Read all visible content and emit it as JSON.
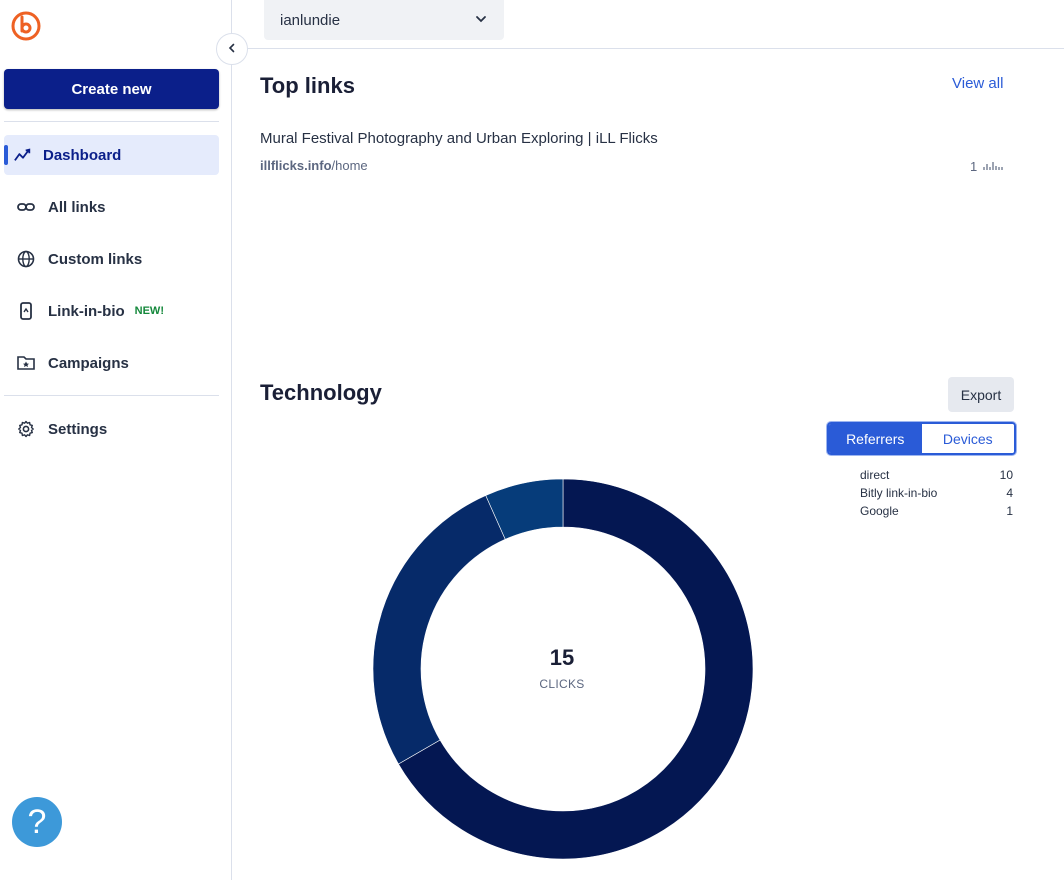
{
  "sidebar": {
    "create_label": "Create new",
    "items": [
      {
        "label": "Dashboard",
        "icon": "chart-trend-icon"
      },
      {
        "label": "All links",
        "icon": "link-icon"
      },
      {
        "label": "Custom links",
        "icon": "globe-icon"
      },
      {
        "label": "Link-in-bio",
        "icon": "phone-icon",
        "badge": "NEW!"
      },
      {
        "label": "Campaigns",
        "icon": "folder-star-icon"
      },
      {
        "label": "Settings",
        "icon": "gear-icon"
      }
    ],
    "help_label": "?"
  },
  "topbar": {
    "account": "ianlundie"
  },
  "top_links": {
    "title": "Top links",
    "view_all": "View all",
    "links": [
      {
        "title": "Mural Festival Photography and Urban Exploring | iLL Flicks",
        "domain": "illflicks.info",
        "path": "/home",
        "clicks": "1"
      }
    ]
  },
  "technology": {
    "title": "Technology",
    "export_label": "Export",
    "tabs": [
      "Referrers",
      "Devices"
    ],
    "active_tab": "Referrers",
    "legend": [
      {
        "name": "direct",
        "value": "10"
      },
      {
        "name": "Bitly link-in-bio",
        "value": "4"
      },
      {
        "name": "Google",
        "value": "1"
      }
    ],
    "total": "15",
    "total_label": "CLICKS"
  },
  "chart_data": {
    "type": "pie",
    "categories": [
      "direct",
      "Bitly link-in-bio",
      "Google"
    ],
    "values": [
      10,
      4,
      1
    ],
    "colors": [
      "#041752",
      "#062a69",
      "#063c7a"
    ]
  }
}
